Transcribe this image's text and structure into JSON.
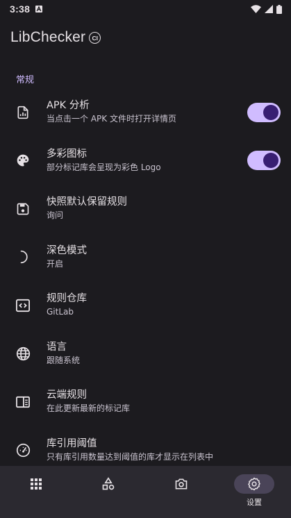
{
  "status_bar": {
    "time": "3:38",
    "icons": [
      "notification-a-icon",
      "wifi-icon",
      "cellular-signal-icon",
      "battery-icon"
    ]
  },
  "app_bar": {
    "title": "LibChecker",
    "badge": "CI"
  },
  "section": {
    "header": "常规"
  },
  "preferences": [
    {
      "title": "APK 分析",
      "summary": "当点击一个 APK 文件时打开详情页",
      "icon": "file-chart-icon",
      "switch": true
    },
    {
      "title": "多彩图标",
      "summary": "部分标记库会呈现为彩色 Logo",
      "icon": "palette-icon",
      "switch": true
    },
    {
      "title": "快照默认保留规则",
      "summary": "询问",
      "icon": "save-icon"
    },
    {
      "title": "深色模式",
      "summary": "开启",
      "icon": "dark-mode-icon"
    },
    {
      "title": "规则仓库",
      "summary": "GitLab",
      "icon": "code-repo-icon"
    },
    {
      "title": "语言",
      "summary": "跟随系统",
      "icon": "language-globe-icon"
    },
    {
      "title": "云端规则",
      "summary": "在此更新最新的标记库",
      "icon": "cloud-rules-icon"
    },
    {
      "title": "库引用阈值",
      "summary": "只有库引用数量达到阈值的库才显示在列表中",
      "icon": "gauge-icon"
    }
  ],
  "bottom_nav": {
    "items": [
      {
        "icon": "apps-grid-icon",
        "label": ""
      },
      {
        "icon": "shapes-icon",
        "label": ""
      },
      {
        "icon": "camera-icon",
        "label": ""
      },
      {
        "icon": "settings-gear-icon",
        "label": "设置",
        "active": true
      }
    ]
  },
  "colors": {
    "background": "#1c1b1f",
    "accent": "#d0bcff",
    "switch_thumb": "#381e72",
    "nav_background": "#2b2930",
    "nav_indicator": "#4a4458"
  }
}
